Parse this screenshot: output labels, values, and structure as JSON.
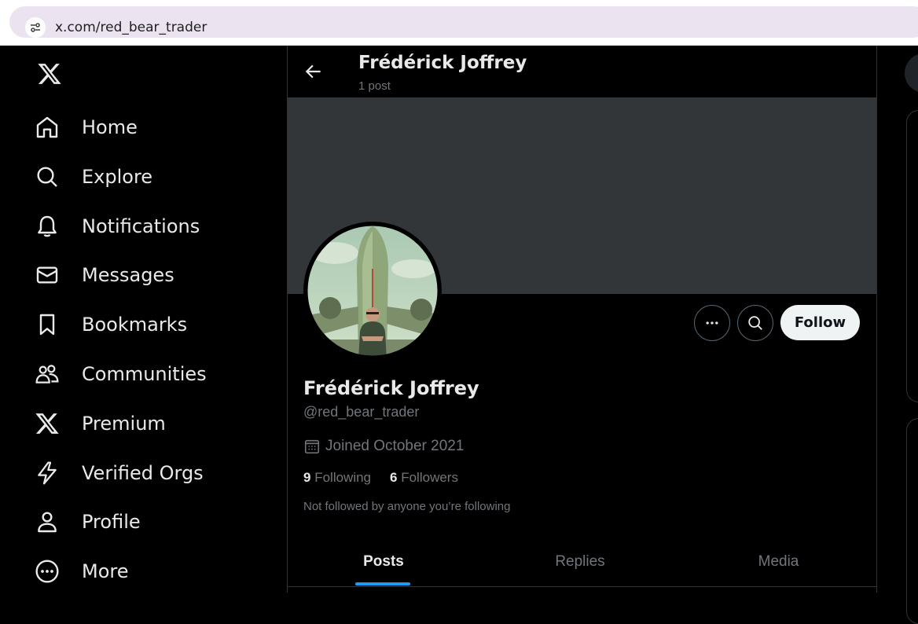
{
  "browser": {
    "url": "x.com/red_bear_trader"
  },
  "nav": {
    "items": [
      {
        "label": "Home",
        "icon": "home-icon"
      },
      {
        "label": "Explore",
        "icon": "search-icon"
      },
      {
        "label": "Notifications",
        "icon": "bell-icon"
      },
      {
        "label": "Messages",
        "icon": "envelope-icon"
      },
      {
        "label": "Bookmarks",
        "icon": "bookmark-icon"
      },
      {
        "label": "Communities",
        "icon": "people-icon"
      },
      {
        "label": "Premium",
        "icon": "x-logo-icon"
      },
      {
        "label": "Verified Orgs",
        "icon": "lightning-icon"
      },
      {
        "label": "Profile",
        "icon": "person-icon"
      },
      {
        "label": "More",
        "icon": "more-circle-icon"
      }
    ]
  },
  "header": {
    "name": "Frédérick Joffrey",
    "post_count": "1 post"
  },
  "profile": {
    "name": "Frédérick Joffrey",
    "handle": "@red_bear_trader",
    "joined": "Joined October 2021",
    "following_count": "9",
    "following_label": "Following",
    "followers_count": "6",
    "followers_label": "Followers",
    "not_followed": "Not followed by anyone you’re following",
    "follow_label": "Follow"
  },
  "tabs": [
    {
      "label": "Posts",
      "active": true
    },
    {
      "label": "Replies",
      "active": false
    },
    {
      "label": "Media",
      "active": false
    }
  ],
  "colors": {
    "accent": "#1d9bf0",
    "banner": "#333639",
    "muted": "#71767b"
  }
}
